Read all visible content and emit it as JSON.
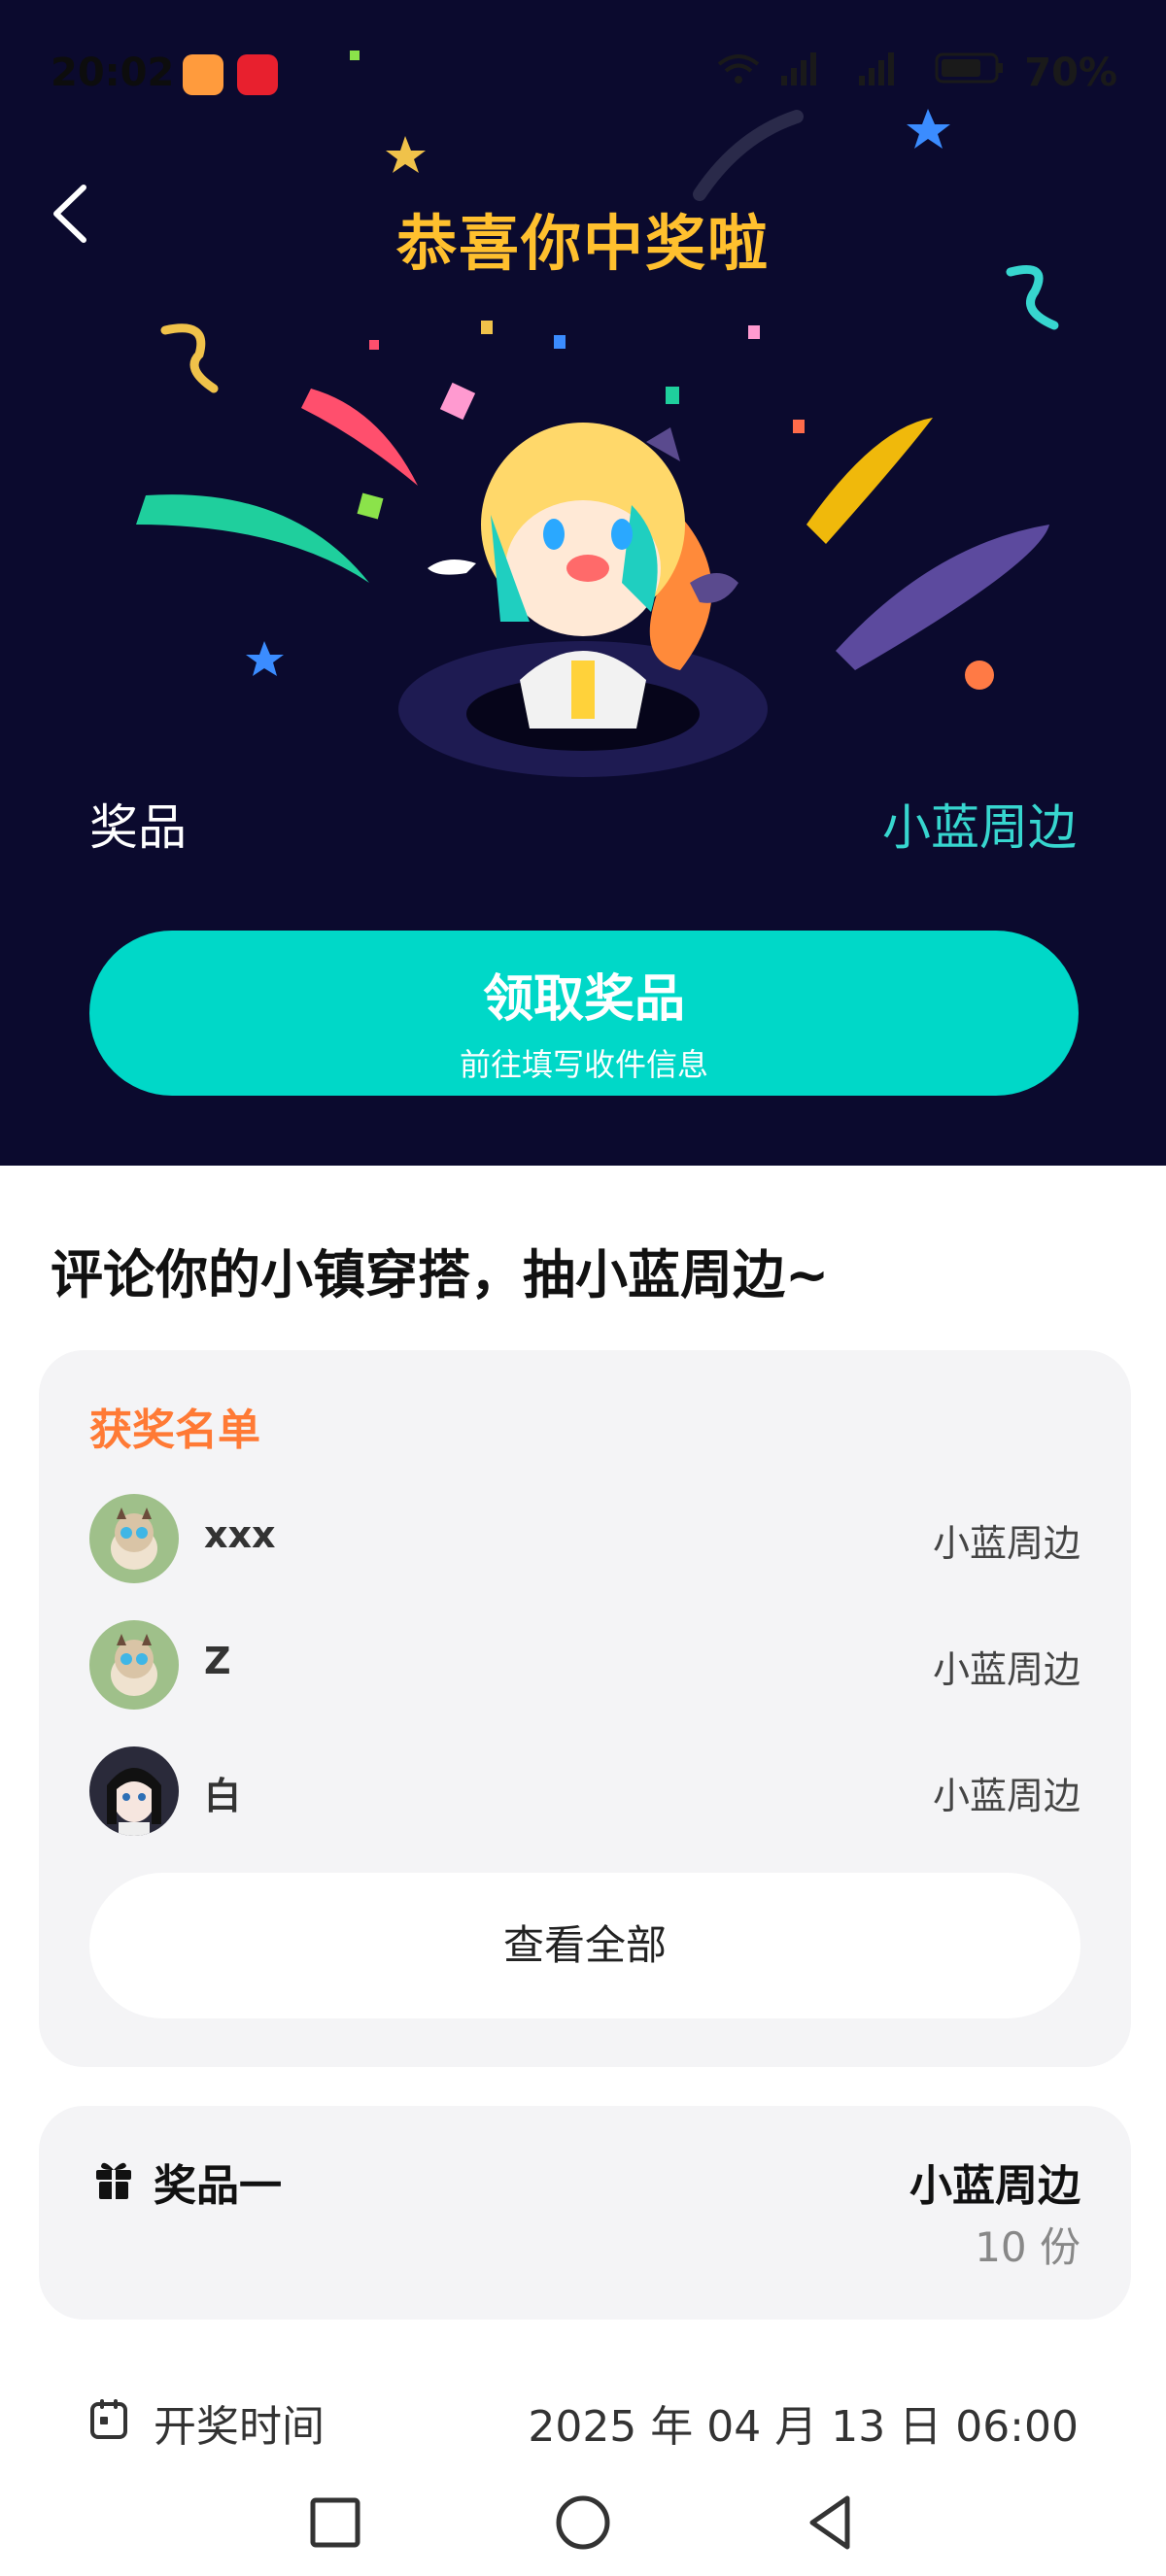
{
  "status": {
    "time": "20:02",
    "battery": "70%"
  },
  "header": {
    "title": "恭喜你中奖啦"
  },
  "prize": {
    "label": "奖品",
    "value": "小蓝周边"
  },
  "claim_button": {
    "label": "领取奖品",
    "sublabel": "前往填写收件信息"
  },
  "section": {
    "title": "评论你的小镇穿搭，抽小蓝周边~"
  },
  "winners": {
    "title": "获奖名单",
    "items": [
      {
        "name": "xxx",
        "prize": "小蓝周边"
      },
      {
        "name": "Z",
        "prize": "小蓝周边"
      },
      {
        "name": "白",
        "prize": "小蓝周边"
      }
    ],
    "see_all": "查看全部"
  },
  "prize_card": {
    "name": "奖品一",
    "item": "小蓝周边",
    "count": "10 份"
  },
  "draw": {
    "label": "开奖时间",
    "time": "2025 年 04 月 13 日 06:00"
  },
  "colors": {
    "hero_bg": "#0b0a2e",
    "title": "#ffc02e",
    "accent_teal": "#00d8c8",
    "winners_title": "#ff7a35"
  }
}
